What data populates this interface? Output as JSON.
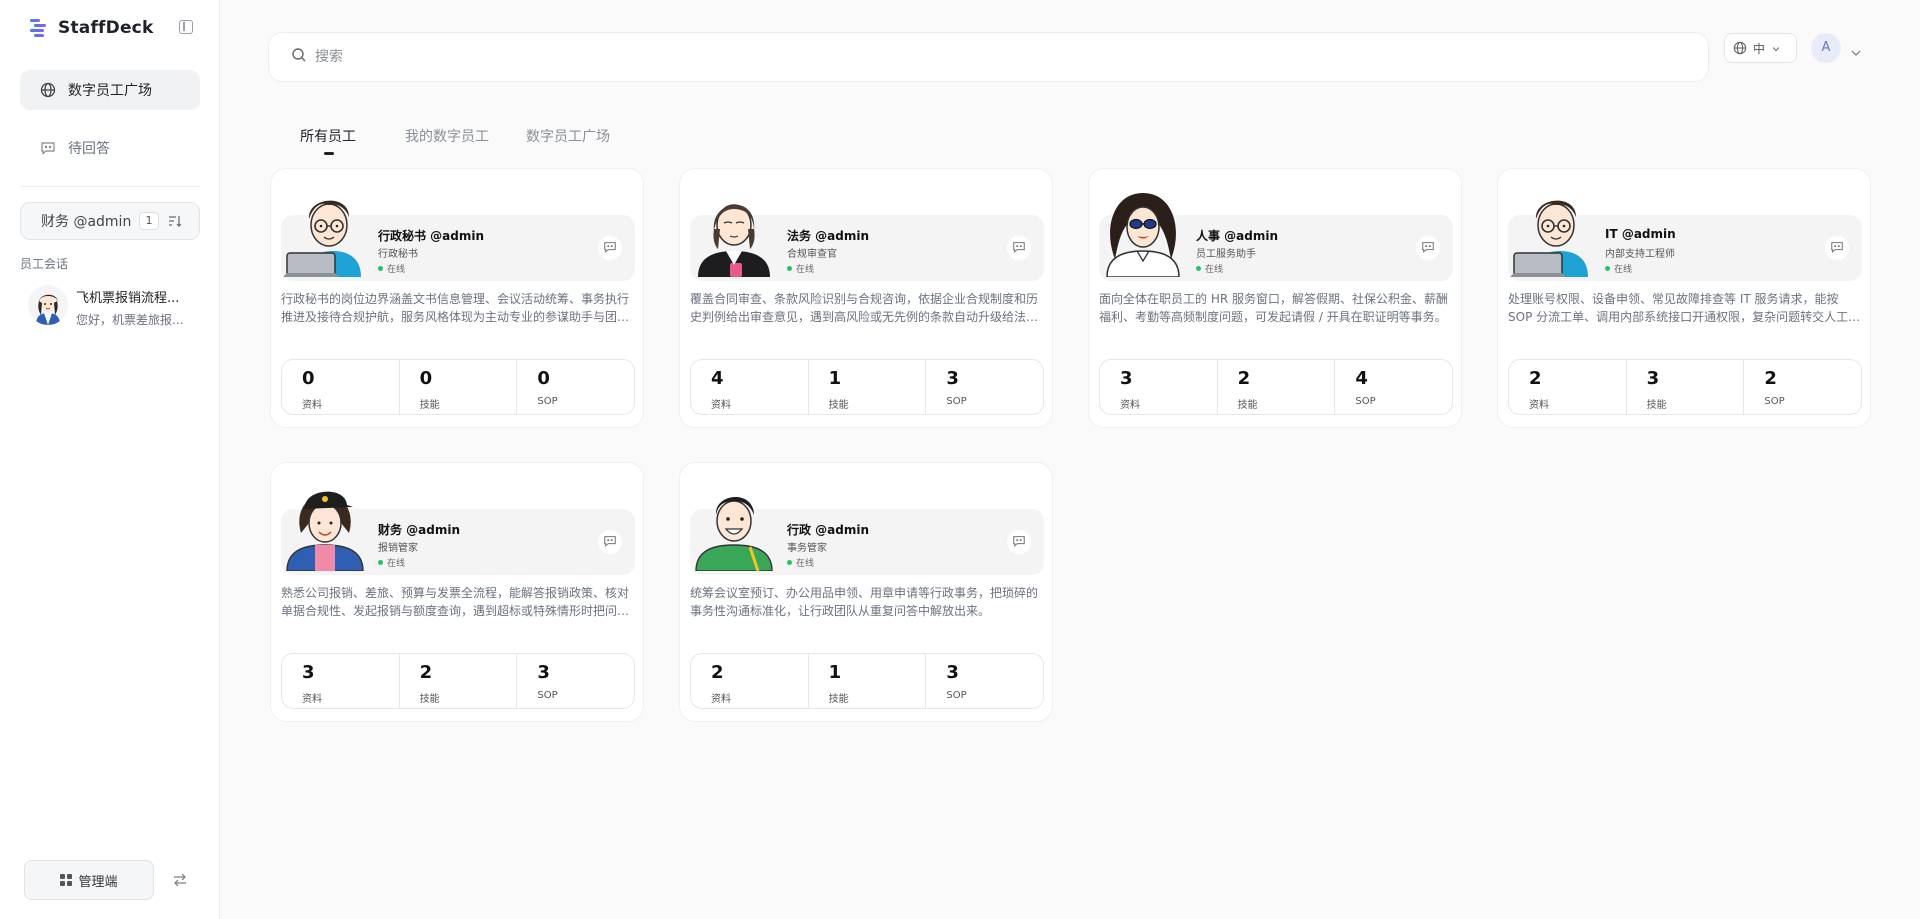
{
  "brand": {
    "name": "StaffDeck"
  },
  "nav": {
    "items": [
      {
        "label": "数字员工广场",
        "icon": "globe-icon",
        "active": true
      },
      {
        "label": "待回答",
        "icon": "chat-icon",
        "active": false
      }
    ]
  },
  "agent_switch": {
    "label": "财务 @admin",
    "count": "1"
  },
  "sessions": {
    "section_label": "员工会话",
    "items": [
      {
        "title": "飞机票报销流程...",
        "preview": "您好，机票差旅报..."
      }
    ]
  },
  "footer": {
    "admin_label": "管理端"
  },
  "search": {
    "placeholder": "搜索"
  },
  "lang": {
    "label": "中"
  },
  "user": {
    "initial": "A"
  },
  "tabs": [
    {
      "label": "所有员工",
      "active": true
    },
    {
      "label": "我的数字员工",
      "active": false
    },
    {
      "label": "数字员工广场",
      "active": false
    }
  ],
  "stat_labels": {
    "docs": "资料",
    "skills": "技能",
    "sop": "SOP"
  },
  "status_label": "在线",
  "cards": [
    {
      "name": "行政秘书 @admin",
      "role": "行政秘书",
      "desc": "行政秘书的岗位边界涵盖文书信息管理、会议活动统筹、事务执行推进及接待合规护航，服务风格体现为主动专业的参谋助手与团队协作的纽带。",
      "docs": "0",
      "skills": "0",
      "sop": "0",
      "avatar": "glasses-laptop"
    },
    {
      "name": "法务 @admin",
      "role": "合规审查官",
      "desc": "覆盖合同审查、条款风险识别与合规咨询，依据企业合规制度和历史判例给出审查意见，遇到高风险或无先例的条款自动升级给法务团队。",
      "docs": "4",
      "skills": "1",
      "sop": "3",
      "avatar": "bob-hair"
    },
    {
      "name": "人事 @admin",
      "role": "员工服务助手",
      "desc": "面向全体在职员工的 HR 服务窗口，解答假期、社保公积金、薪酬福利、考勤等高频制度问题，可发起请假 / 开具在职证明等事务。",
      "docs": "3",
      "skills": "2",
      "sop": "4",
      "avatar": "sunglasses-curly"
    },
    {
      "name": "IT @admin",
      "role": "内部支持工程师",
      "desc": "处理账号权限、设备申领、常见故障排查等 IT 服务请求，能按 SOP 分流工单、调用内部系统接口开通权限，复杂问题转交人工工程师。",
      "docs": "2",
      "skills": "3",
      "sop": "2",
      "avatar": "glasses-laptop"
    },
    {
      "name": "财务 @admin",
      "role": "报销管家",
      "desc": "熟悉公司报销、差旅、预算与发票全流程，能解答报销政策、核对单据合规性、发起报销与额度查询，遇到超标或特殊情形时把问题转交财务。",
      "docs": "3",
      "skills": "2",
      "sop": "3",
      "avatar": "cap-girl"
    },
    {
      "name": "行政 @admin",
      "role": "事务管家",
      "desc": "统筹会议室预订、办公用品申领、用章申请等行政事务，把琐碎的事务性沟通标准化，让行政团队从重复问答中解放出来。",
      "docs": "2",
      "skills": "1",
      "sop": "3",
      "avatar": "green-guy"
    }
  ],
  "colors": {
    "online": "#22c55e",
    "accent": "#3b82f6"
  }
}
